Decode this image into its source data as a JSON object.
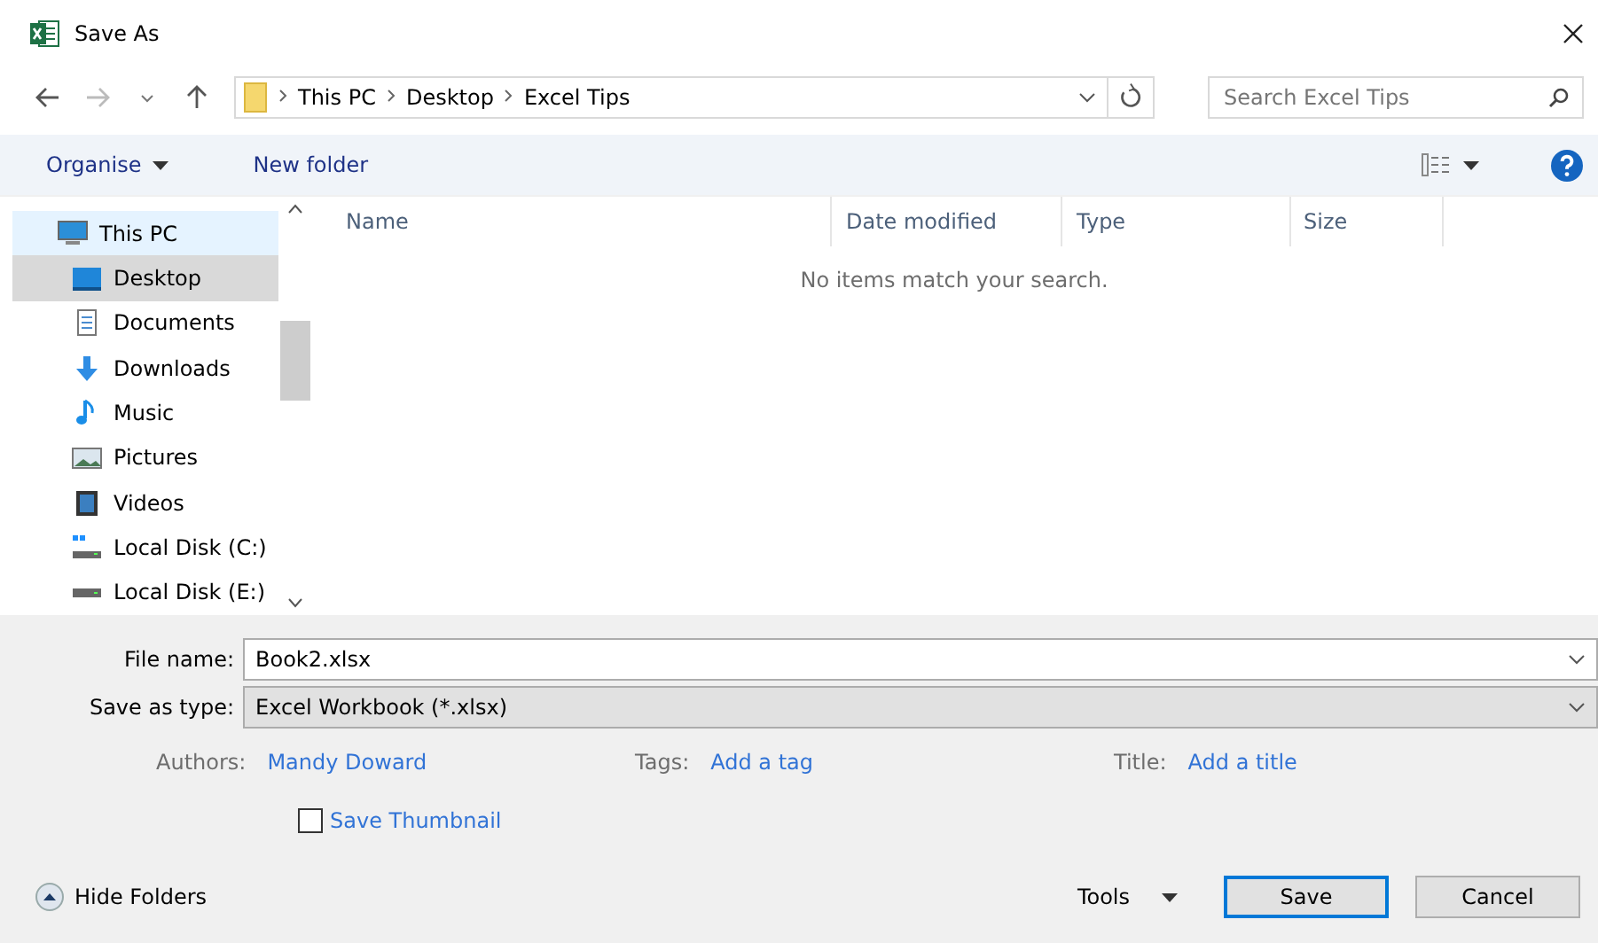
{
  "window": {
    "title": "Save As"
  },
  "breadcrumb": [
    "This PC",
    "Desktop",
    "Excel Tips"
  ],
  "search": {
    "placeholder": "Search Excel Tips"
  },
  "toolbar": {
    "organise": "Organise",
    "new_folder": "New folder"
  },
  "sidebar": {
    "items": [
      {
        "label": "This PC",
        "kind": "pc",
        "selected": false,
        "hover": true,
        "child": false
      },
      {
        "label": "Desktop",
        "kind": "desktop",
        "selected": true,
        "hover": false,
        "child": true
      },
      {
        "label": "Documents",
        "kind": "documents",
        "selected": false,
        "hover": false,
        "child": true
      },
      {
        "label": "Downloads",
        "kind": "downloads",
        "selected": false,
        "hover": false,
        "child": true
      },
      {
        "label": "Music",
        "kind": "music",
        "selected": false,
        "hover": false,
        "child": true
      },
      {
        "label": "Pictures",
        "kind": "pictures",
        "selected": false,
        "hover": false,
        "child": true
      },
      {
        "label": "Videos",
        "kind": "videos",
        "selected": false,
        "hover": false,
        "child": true
      },
      {
        "label": "Local Disk (C:)",
        "kind": "windisk",
        "selected": false,
        "hover": false,
        "child": true
      },
      {
        "label": "Local Disk (E:)",
        "kind": "disk",
        "selected": false,
        "hover": false,
        "child": true
      }
    ]
  },
  "table": {
    "columns": [
      "Name",
      "Date modified",
      "Type",
      "Size"
    ],
    "empty_message": "No items match your search."
  },
  "form": {
    "file_name_label": "File name:",
    "file_name": "Book2.xlsx",
    "type_label": "Save as type:",
    "type": "Excel Workbook (*.xlsx)"
  },
  "meta": [
    {
      "label": "Authors:",
      "value": "Mandy Doward"
    },
    {
      "label": "Tags:",
      "value": "Add a tag"
    },
    {
      "label": "Title:",
      "value": "Add a title"
    }
  ],
  "thumbnail": {
    "label": "Save Thumbnail",
    "checked": false
  },
  "footer": {
    "hide_folders": "Hide Folders",
    "tools": "Tools",
    "save": "Save",
    "cancel": "Cancel"
  }
}
